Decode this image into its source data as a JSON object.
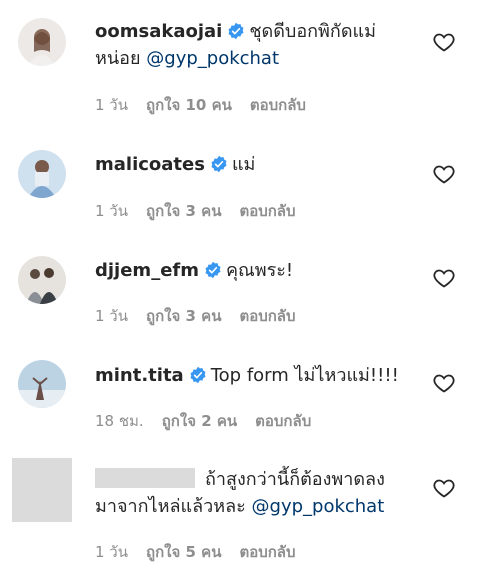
{
  "comments": [
    {
      "username": "oomsakaojai",
      "verified": true,
      "text": "ชุดดีบอกพิกัดแม่",
      "text2": "หน่อย",
      "mention": "@gyp_pokchat",
      "time": "1 วัน",
      "likes": "ถูกใจ 10 คน",
      "reply": "ตอบกลับ"
    },
    {
      "username": "malicoates",
      "verified": true,
      "text": "แม่",
      "time": "1 วัน",
      "likes": "ถูกใจ 3 คน",
      "reply": "ตอบกลับ"
    },
    {
      "username": "djjem_efm",
      "verified": true,
      "text": "คุณพระ!",
      "time": "1 วัน",
      "likes": "ถูกใจ 3 คน",
      "reply": "ตอบกลับ"
    },
    {
      "username": "mint.tita",
      "verified": true,
      "text": "Top form ไม่ไหวแม่!!!!",
      "time": "18 ชม.",
      "likes": "ถูกใจ 2 คน",
      "reply": "ตอบกลับ"
    },
    {
      "username": "",
      "verified": false,
      "text": "ถ้าสูงกว่านี้ก็ต้องพาดลง",
      "text2": "มาจากไหล่แล้วหละ",
      "mention": "@gyp_pokchat",
      "time": "1 วัน",
      "likes": "ถูกใจ 5 คน",
      "reply": "ตอบกลับ"
    }
  ],
  "colors": {
    "verified": "#3897f0",
    "mention": "#00376b",
    "meta": "#8e8e8e"
  }
}
